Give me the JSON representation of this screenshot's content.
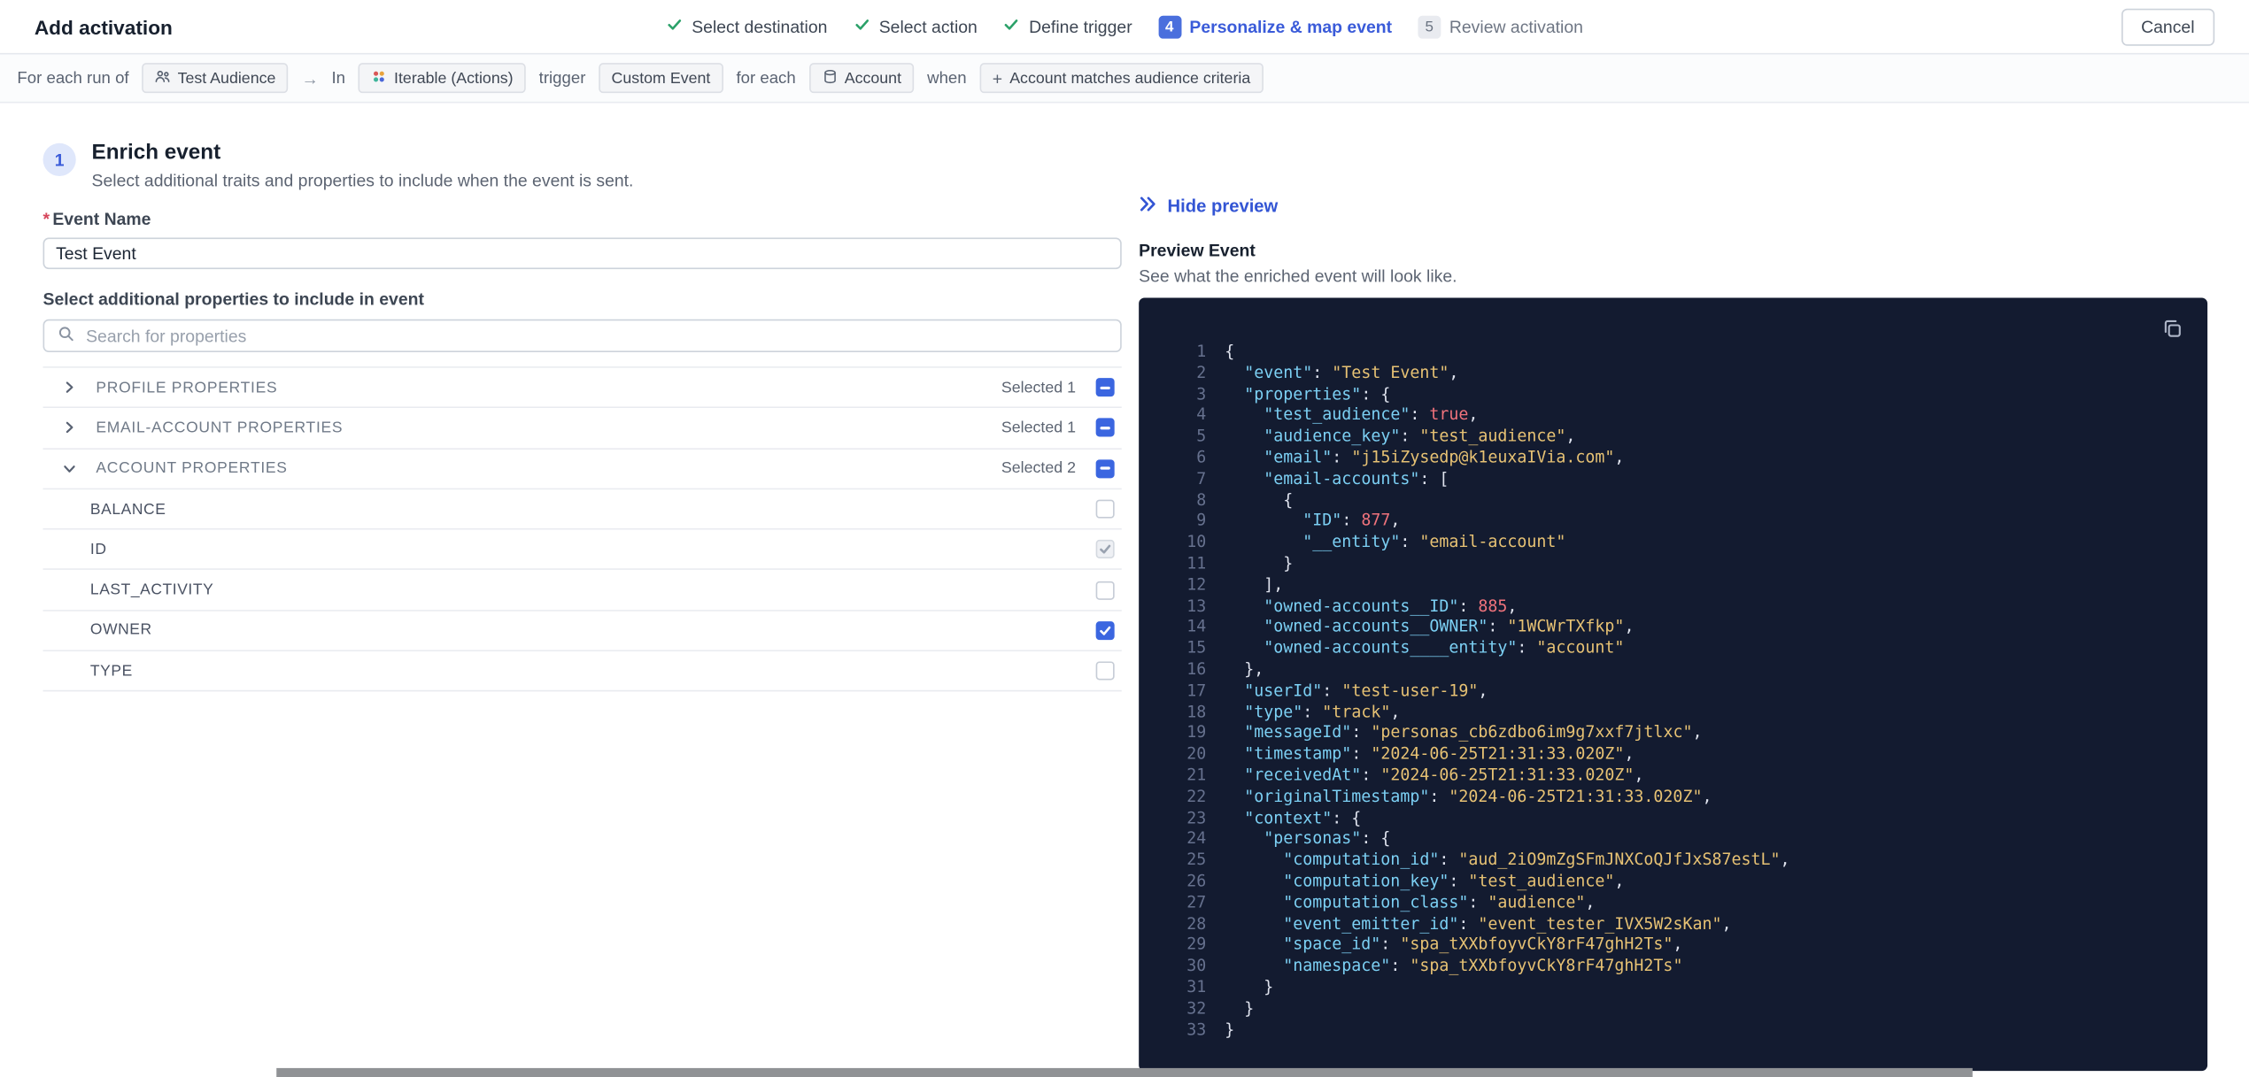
{
  "header": {
    "title": "Add activation",
    "cancel_label": "Cancel",
    "steps": [
      {
        "label": "Select destination",
        "state": "completed"
      },
      {
        "label": "Select action",
        "state": "completed"
      },
      {
        "label": "Define trigger",
        "state": "completed"
      },
      {
        "number": "4",
        "label": "Personalize & map event",
        "state": "current"
      },
      {
        "number": "5",
        "label": "Review activation",
        "state": "upcoming"
      }
    ]
  },
  "trigger_bar": {
    "for_each_run_of": "For each run of",
    "audience_chip": "Test Audience",
    "arrow": "→",
    "in_label": "In",
    "destination_chip": "Iterable (Actions)",
    "trigger_label": "trigger",
    "event_chip": "Custom Event",
    "for_each_label": "for each",
    "entity_chip": "Account",
    "when_label": "when",
    "criteria_plus": "+",
    "criteria_chip": "Account matches audience criteria"
  },
  "enrich": {
    "step_number": "1",
    "title": "Enrich event",
    "subtitle": "Select additional traits and properties to include when the event is sent.",
    "required_marker": "*",
    "event_name_label": "Event Name",
    "event_name_value": "Test Event",
    "properties_label": "Select additional properties to include in event",
    "search_placeholder": "Search for properties",
    "groups": [
      {
        "label": "PROFILE PROPERTIES",
        "selected": "Selected 1",
        "expanded": false,
        "checkbox": "indeterminate"
      },
      {
        "label": "EMAIL-ACCOUNT PROPERTIES",
        "selected": "Selected 1",
        "expanded": false,
        "checkbox": "indeterminate"
      },
      {
        "label": "ACCOUNT PROPERTIES",
        "selected": "Selected 2",
        "expanded": true,
        "checkbox": "indeterminate"
      }
    ],
    "account_properties": [
      {
        "label": "BALANCE",
        "checked": false
      },
      {
        "label": "ID",
        "checked": true,
        "disabled": true
      },
      {
        "label": "LAST_ACTIVITY",
        "checked": false
      },
      {
        "label": "OWNER",
        "checked": true
      },
      {
        "label": "TYPE",
        "checked": false
      }
    ]
  },
  "preview": {
    "hide_label": "Hide preview",
    "title": "Preview Event",
    "subtitle": "See what the enriched event will look like.",
    "code_lines": [
      "{",
      "  \"event\": \"Test Event\",",
      "  \"properties\": {",
      "    \"test_audience\": true,",
      "    \"audience_key\": \"test_audience\",",
      "    \"email\": \"j15iZysedp@k1euxaIVia.com\",",
      "    \"email-accounts\": [",
      "      {",
      "        \"ID\": 877,",
      "        \"__entity\": \"email-account\"",
      "      }",
      "    ],",
      "    \"owned-accounts__ID\": 885,",
      "    \"owned-accounts__OWNER\": \"1WCWrTXfkp\",",
      "    \"owned-accounts____entity\": \"account\"",
      "  },",
      "  \"userId\": \"test-user-19\",",
      "  \"type\": \"track\",",
      "  \"messageId\": \"personas_cb6zdbo6im9g7xxf7jtlxc\",",
      "  \"timestamp\": \"2024-06-25T21:31:33.020Z\",",
      "  \"receivedAt\": \"2024-06-25T21:31:33.020Z\",",
      "  \"originalTimestamp\": \"2024-06-25T21:31:33.020Z\",",
      "  \"context\": {",
      "    \"personas\": {",
      "      \"computation_id\": \"aud_2iO9mZgSFmJNXCoQJfJxS87estL\",",
      "      \"computation_key\": \"test_audience\",",
      "      \"computation_class\": \"audience\",",
      "      \"event_emitter_id\": \"event_tester_IVX5W2sKan\",",
      "      \"space_id\": \"spa_tXXbfoyvCkY8rF47ghH2Ts\",",
      "      \"namespace\": \"spa_tXXbfoyvCkY8rF47ghH2Ts\"",
      "    }",
      "  }",
      "}"
    ]
  },
  "colors": {
    "accent_blue": "#3b66e0",
    "step_current_blue": "#4a6fdd",
    "done_check_green": "#2ba169",
    "required_red": "#d5455a",
    "code_background": "#131b30",
    "code_key": "#7cd0f4",
    "code_string": "#e7c274",
    "code_number": "#f0737c"
  }
}
